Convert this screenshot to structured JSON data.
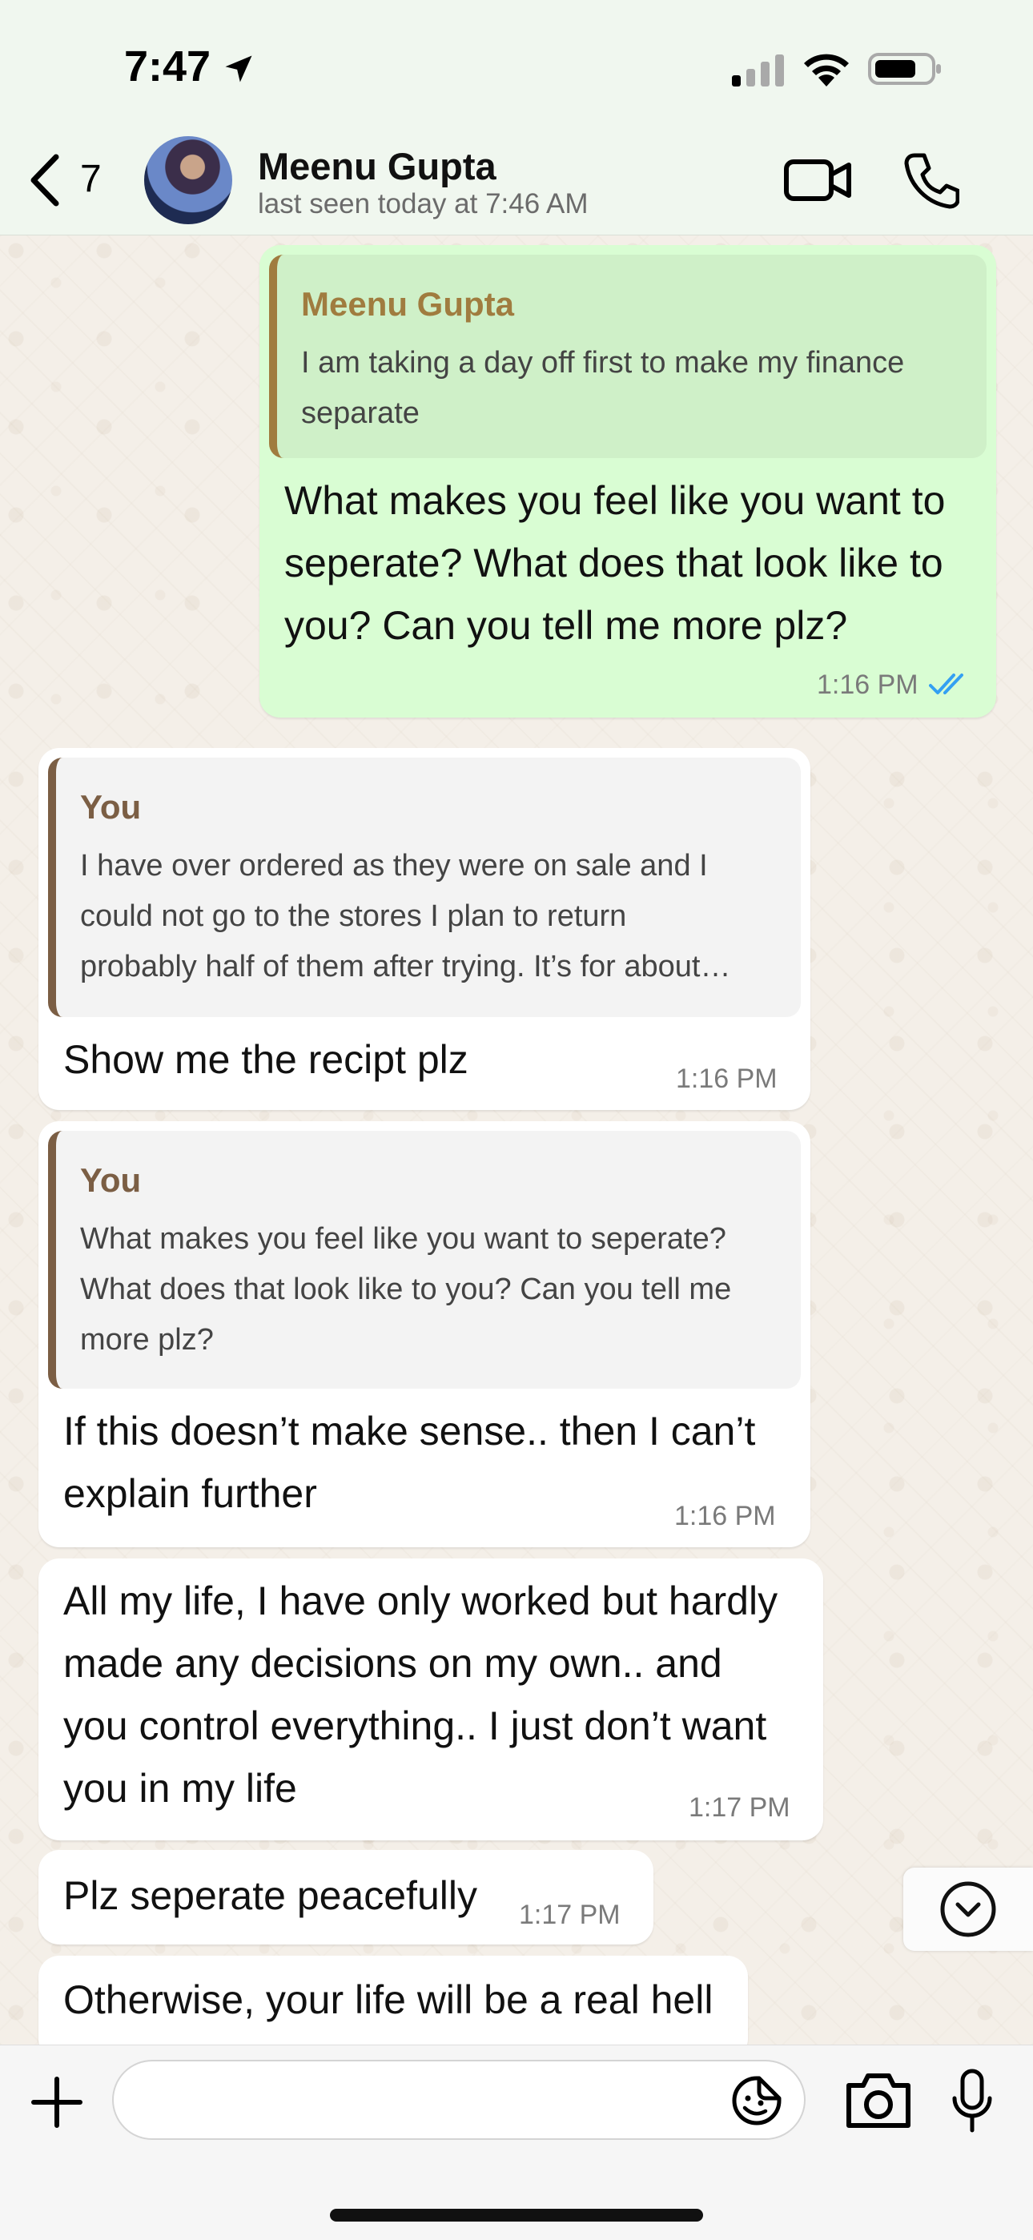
{
  "status_bar": {
    "time": "7:47",
    "icons": [
      "location-arrow-icon",
      "signal-icon",
      "wifi-icon",
      "battery-icon"
    ]
  },
  "header": {
    "back_count": "7",
    "contact_name": "Meenu Gupta",
    "last_seen": "last seen today at 7:46 AM",
    "icons": [
      "back-chevron-icon",
      "video-call-icon",
      "phone-call-icon"
    ]
  },
  "messages": [
    {
      "direction": "outgoing",
      "quote_author": "Meenu Gupta",
      "quote_line1": "I am taking a day off first to make my finance",
      "quote_line2": "separate",
      "line1": "What makes you feel like you want to",
      "line2": "seperate? What does that look like to",
      "line3": "you? Can you tell me more plz?",
      "time": "1:16 PM",
      "status": "read"
    },
    {
      "direction": "incoming",
      "quote_author": "You",
      "quote_line1": "I have over ordered as they were on sale and I",
      "quote_line2": "could not go to the stores I plan to return",
      "quote_line3": "probably half of them after trying. It’s for about…",
      "line1": "Show me the recipt plz",
      "time": "1:16 PM"
    },
    {
      "direction": "incoming",
      "quote_author": "You",
      "quote_line1": "What makes you feel like you want to seperate?",
      "quote_line2": "What does that look like to you? Can you tell me",
      "quote_line3": "more plz?",
      "line1": "If this doesn’t make sense.. then I can’t",
      "line2": "explain further",
      "time": "1:16 PM"
    },
    {
      "direction": "incoming",
      "line1": "All my life, I have only worked but hardly",
      "line2": "made any decisions on my own.. and",
      "line3": "you control everything.. I just don’t want",
      "line4": "you in my life",
      "time": "1:17 PM"
    },
    {
      "direction": "incoming",
      "line1": "Plz seperate peacefully",
      "time": "1:17 PM"
    },
    {
      "direction": "incoming",
      "line1": "Otherwise, your life will be a real hell"
    }
  ],
  "composer": {
    "placeholder": "",
    "icons": [
      "plus-icon",
      "sticker-icon",
      "camera-icon",
      "microphone-icon"
    ]
  },
  "colors": {
    "outgoing_bubble": "#d9fdd3",
    "incoming_bubble": "#ffffff",
    "read_ticks": "#34a0f2",
    "quote_author_outgoing": "#a07c3f",
    "quote_author_incoming": "#7b5e44"
  }
}
